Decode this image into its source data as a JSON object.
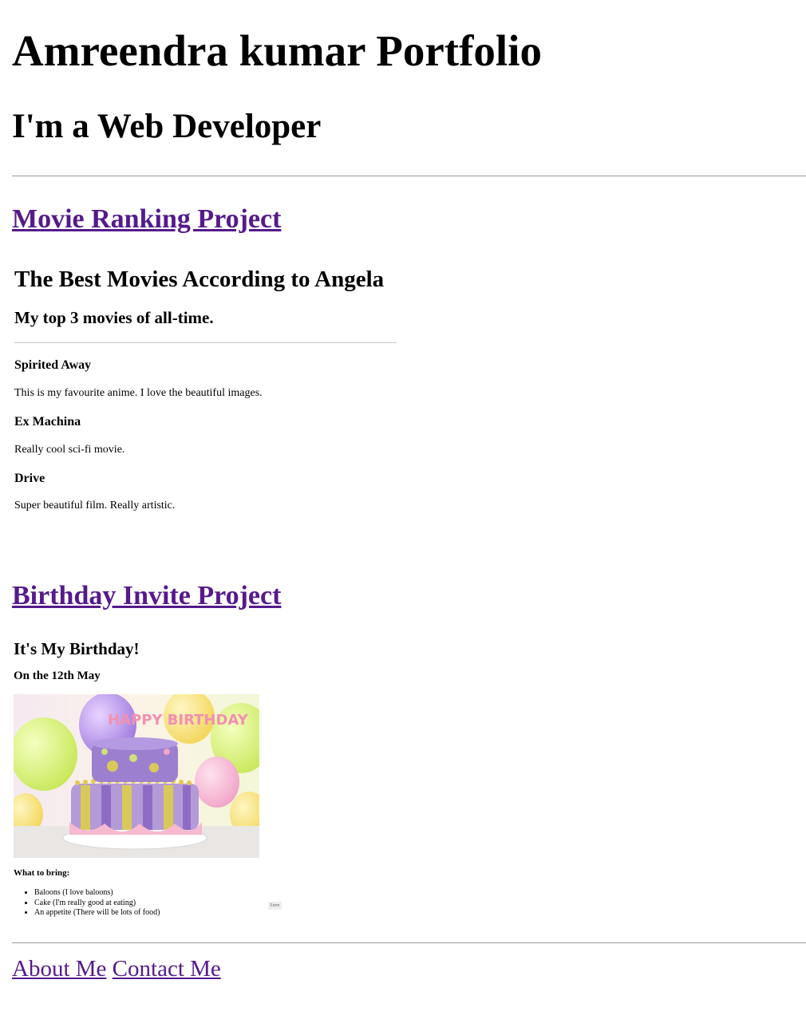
{
  "header": {
    "title": "Amreendra kumar Portfolio",
    "subtitle": "I'm a Web Developer"
  },
  "projects": [
    {
      "link_label": "Movie Ranking Project",
      "preview": {
        "title": "The Best Movies According to Angela",
        "subtitle": "My top 3 movies of all-time.",
        "movies": [
          {
            "name": "Spirited Away",
            "description": "This is my favourite anime. I love the beautiful images."
          },
          {
            "name": "Ex Machina",
            "description": "Really cool sci-fi movie."
          },
          {
            "name": "Drive",
            "description": "Super beautiful film. Really artistic."
          }
        ]
      }
    },
    {
      "link_label": "Birthday Invite Project",
      "preview": {
        "title": "It's My Birthday!",
        "date": "On the 12th May",
        "cake_topper": "HAPPY BIRTHDAY",
        "bring_heading": "What to bring:",
        "items": [
          "Baloons (I love baloons)",
          "Cake (I'm really good at eating)",
          "An appetite (There will be lots of food)"
        ],
        "form_stub": "Form"
      }
    }
  ],
  "footer": {
    "links": [
      "About Me",
      "Contact Me"
    ]
  },
  "colors": {
    "visited_link": "#551a8b",
    "rule": "#9a9a9a",
    "text": "#000000"
  }
}
